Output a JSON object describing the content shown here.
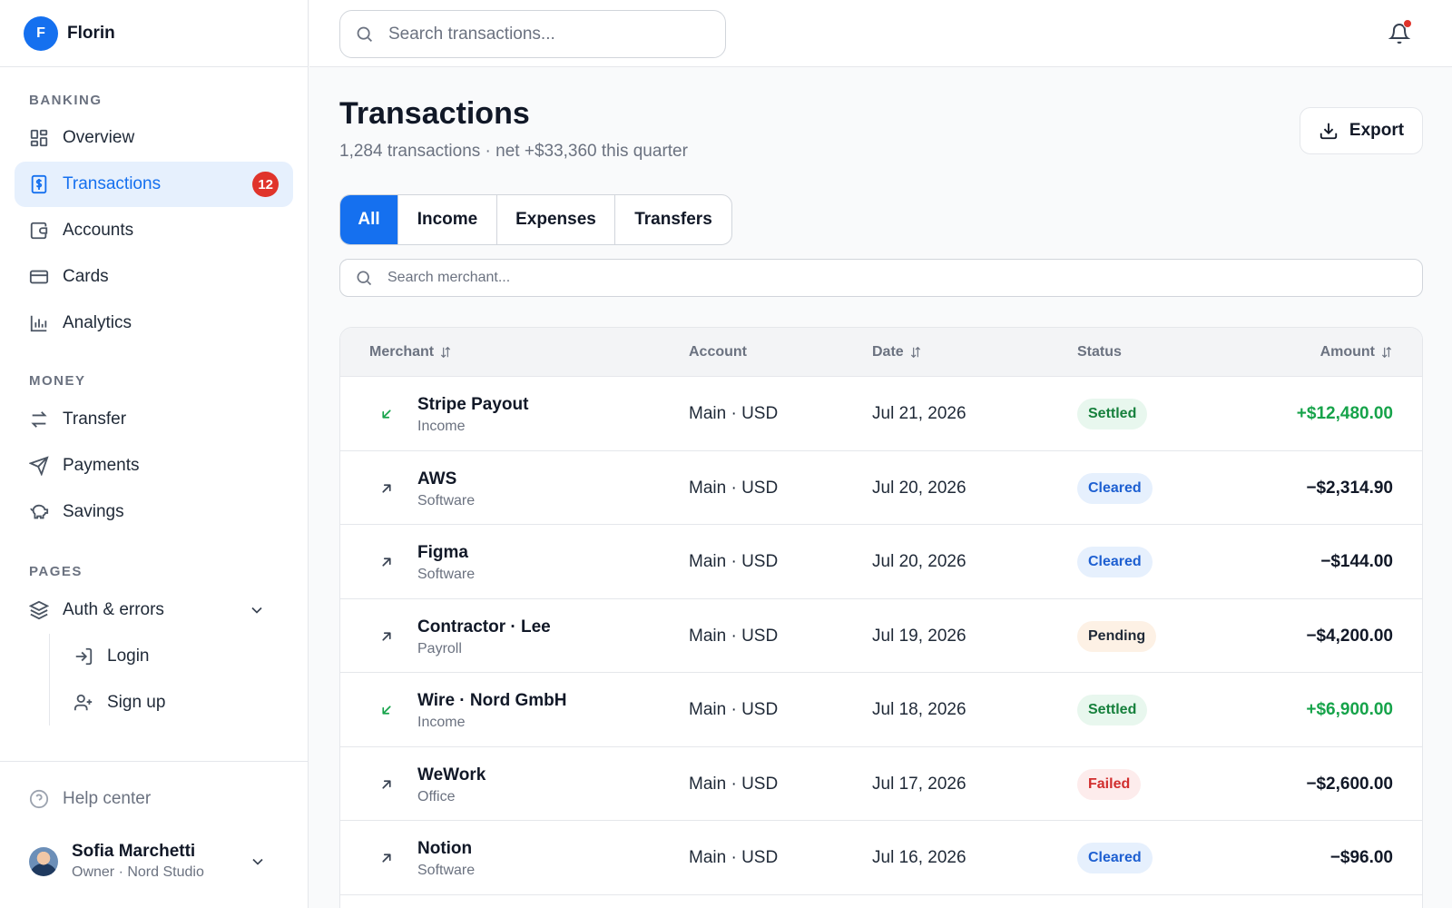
{
  "app": {
    "logo_letter": "F",
    "name": "Florin"
  },
  "sidebar": {
    "sections": [
      {
        "label": "BANKING",
        "items": [
          {
            "label": "Overview",
            "icon": "grid-icon"
          },
          {
            "label": "Transactions",
            "icon": "receipt-icon",
            "active": true,
            "badge": "12"
          },
          {
            "label": "Accounts",
            "icon": "wallet-icon"
          },
          {
            "label": "Cards",
            "icon": "credit-card-icon"
          },
          {
            "label": "Analytics",
            "icon": "bar-chart-icon"
          }
        ]
      },
      {
        "label": "MONEY",
        "items": [
          {
            "label": "Transfer",
            "icon": "transfer-arrows-icon"
          },
          {
            "label": "Payments",
            "icon": "send-icon"
          },
          {
            "label": "Savings",
            "icon": "piggy-bank-icon"
          }
        ]
      },
      {
        "label": "PAGES",
        "items": [
          {
            "label": "Auth & errors",
            "icon": "layers-icon",
            "expanded": true,
            "children": [
              {
                "label": "Login",
                "icon": "login-icon"
              },
              {
                "label": "Sign up",
                "icon": "user-plus-icon"
              }
            ]
          }
        ]
      }
    ],
    "footer": {
      "help_label": "Help center",
      "user_name": "Sofia Marchetti",
      "user_role": "Owner · Nord Studio"
    }
  },
  "topbar": {
    "search_placeholder": "Search transactions..."
  },
  "page": {
    "title": "Transactions",
    "subtitle": "1,284 transactions · net +$33,360 this quarter",
    "export_label": "Export",
    "tabs": [
      "All",
      "Income",
      "Expenses",
      "Transfers"
    ],
    "active_tab": "All",
    "merchant_search_placeholder": "Search merchant..."
  },
  "table": {
    "columns": {
      "merchant": "Merchant",
      "account": "Account",
      "date": "Date",
      "status": "Status",
      "amount": "Amount"
    },
    "rows": [
      {
        "direction": "in",
        "merchant": "Stripe Payout",
        "category": "Income",
        "account": "Main · USD",
        "date": "Jul 21, 2026",
        "status": "Settled",
        "amount": "+$12,480.00"
      },
      {
        "direction": "out",
        "merchant": "AWS",
        "category": "Software",
        "account": "Main · USD",
        "date": "Jul 20, 2026",
        "status": "Cleared",
        "amount": "−$2,314.90"
      },
      {
        "direction": "out",
        "merchant": "Figma",
        "category": "Software",
        "account": "Main · USD",
        "date": "Jul 20, 2026",
        "status": "Cleared",
        "amount": "−$144.00"
      },
      {
        "direction": "out",
        "merchant": "Contractor · Lee",
        "category": "Payroll",
        "account": "Main · USD",
        "date": "Jul 19, 2026",
        "status": "Pending",
        "amount": "−$4,200.00"
      },
      {
        "direction": "in",
        "merchant": "Wire · Nord GmbH",
        "category": "Income",
        "account": "Main · USD",
        "date": "Jul 18, 2026",
        "status": "Settled",
        "amount": "+$6,900.00"
      },
      {
        "direction": "out",
        "merchant": "WeWork",
        "category": "Office",
        "account": "Main · USD",
        "date": "Jul 17, 2026",
        "status": "Failed",
        "amount": "−$2,600.00"
      },
      {
        "direction": "out",
        "merchant": "Notion",
        "category": "Software",
        "account": "Main · USD",
        "date": "Jul 16, 2026",
        "status": "Cleared",
        "amount": "−$96.00"
      }
    ]
  },
  "colors": {
    "accent": "#1570ef",
    "badge": "#e0342b",
    "income": "#16a34a",
    "settled_bg": "#e8f7ee",
    "cleared_bg": "#e6f0fd",
    "pending_bg": "#fdf1e5",
    "failed_bg": "#fdecec"
  }
}
